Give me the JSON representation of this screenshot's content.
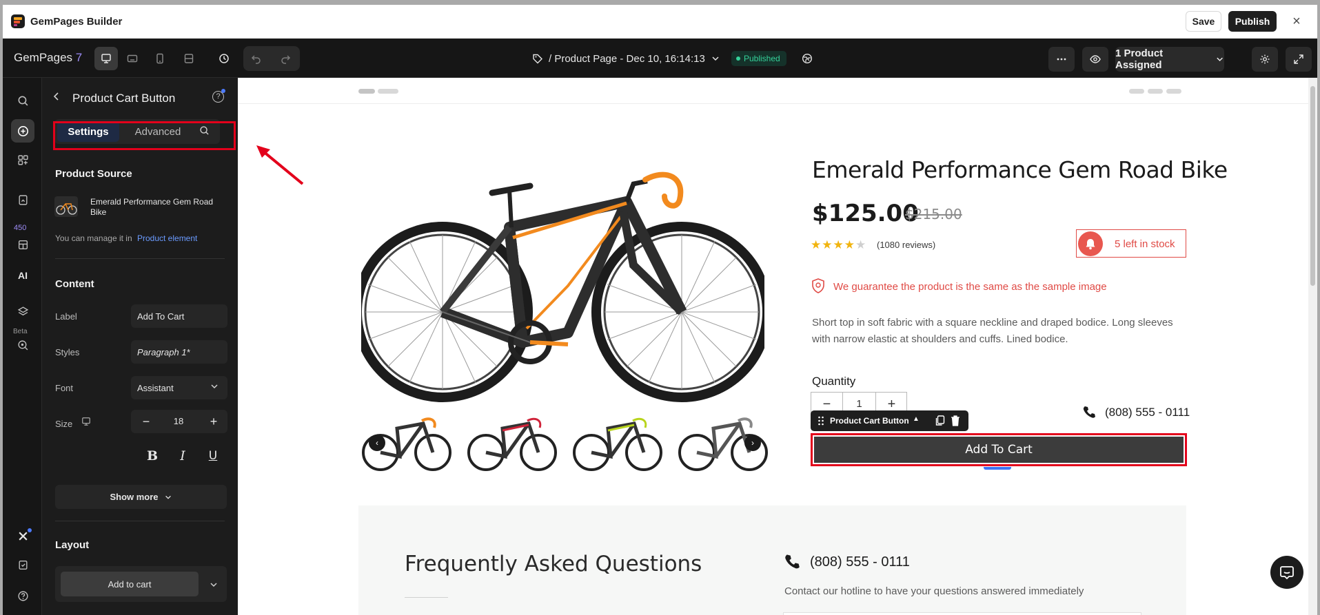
{
  "window": {
    "app_title": "GemPages Builder",
    "save_label": "Save",
    "publish_label": "Publish",
    "close_icon": "×"
  },
  "toolbar": {
    "brand": "GemPages",
    "brand_version": "7",
    "page_name": "/ Product Page - Dec 10, 16:14:13",
    "status": "Published",
    "assigned": "1 Product Assigned"
  },
  "rail": {
    "count_badge": "450",
    "ai_label": "AI",
    "beta_label": "Beta"
  },
  "panel": {
    "title": "Product Cart Button",
    "tabs": {
      "settings": "Settings",
      "advanced": "Advanced"
    },
    "product_source": {
      "heading": "Product Source",
      "product_name": "Emerald Performance Gem Road Bike",
      "manage_prefix": "You can manage it in",
      "manage_link": "Product element"
    },
    "content": {
      "heading": "Content",
      "label_field": "Label",
      "label_value": "Add To Cart",
      "styles_field": "Styles",
      "styles_value": "Paragraph 1*",
      "font_field": "Font",
      "font_value": "Assistant",
      "size_field": "Size",
      "size_value": "18",
      "size_minus": "−",
      "size_plus": "+",
      "bold": "B",
      "italic": "I",
      "underline": "U",
      "show_more": "Show more"
    },
    "layout": {
      "heading": "Layout",
      "option": "Add to cart"
    }
  },
  "product": {
    "title": "Emerald Performance Gem Road Bike",
    "price": "$125.00",
    "compare_price": "$215.00",
    "rating_filled": "★★★★",
    "rating_empty": "★",
    "reviews": "(1080 reviews)",
    "stock": "5 left in stock",
    "guarantee": "We guarantee the product is the same as the sample image",
    "description": "Short top in soft fabric with a square neckline and draped bodice. Long sleeves with narrow elastic at shoulders and cuffs. Lined bodice.",
    "quantity_label": "Quantity",
    "quantity_value": "1",
    "quantity_minus": "−",
    "quantity_plus": "+",
    "phone": "(808) 555 - 0111",
    "cart_button": "Add To Cart",
    "element_toolbar_label": "Product Cart Button",
    "thumb_prev": "‹",
    "thumb_next": "›"
  },
  "faq": {
    "title": "Frequently Asked Questions",
    "phone": "(808) 555 - 0111",
    "hotline": "Contact our hotline to have your questions answered immediately"
  },
  "colors": {
    "accent_red": "#e3001b",
    "stock_red": "#e04a45",
    "published_green": "#35d29a",
    "link_blue": "#6b9bff",
    "brand_purple": "#9d8cf6",
    "bike_orange": "#f28a1e"
  }
}
